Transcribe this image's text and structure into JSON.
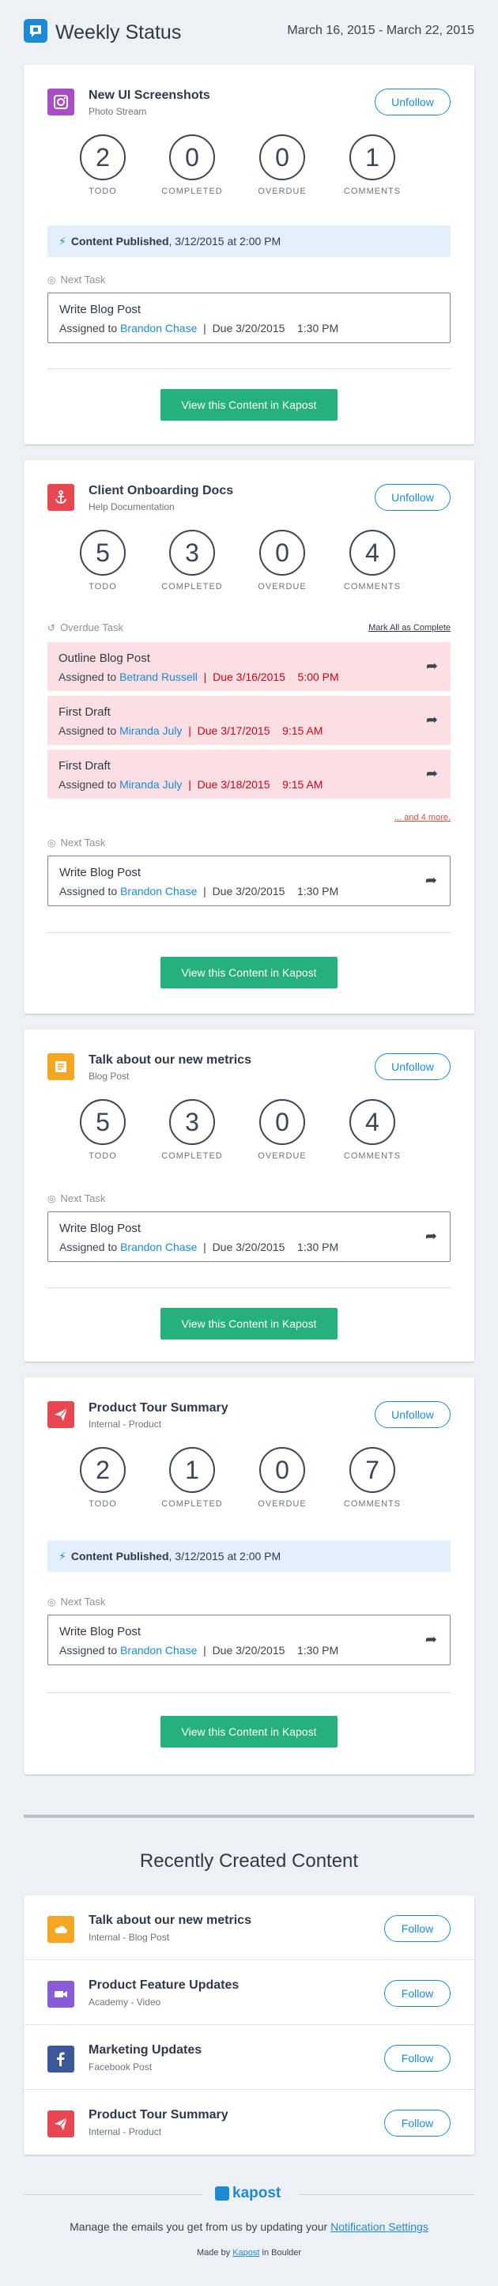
{
  "header": {
    "title": "Weekly Status",
    "date_range": "March 16, 2015 - March 22, 2015"
  },
  "stat_labels": {
    "todo": "TODO",
    "completed": "COMPLETED",
    "overdue": "OVERDUE",
    "comments": "COMMENTS"
  },
  "cards": [
    {
      "title": "New UI Screenshots",
      "subtitle": "Photo Stream",
      "icon": "instagram-icon",
      "icon_color": "#a84fc8",
      "unfollow_label": "Unfollow",
      "stats": {
        "todo": "2",
        "completed": "0",
        "overdue": "0",
        "comments": "1"
      },
      "published": {
        "label": "Content Published",
        "text": ", 3/12/2015 at 2:00 PM"
      },
      "next_task_label": "Next Task",
      "next_task": {
        "title": "Write Blog Post",
        "assigned_prefix": "Assigned to ",
        "assignee": "Brandon Chase",
        "sep": "|",
        "due": "Due 3/20/2015",
        "time": "1:30 PM"
      },
      "cta_label": "View this Content in Kapost"
    },
    {
      "title": "Client Onboarding Docs",
      "subtitle": "Help Documentation",
      "icon": "anchor-icon",
      "icon_color": "#e8474f",
      "unfollow_label": "Unfollow",
      "stats": {
        "todo": "5",
        "completed": "3",
        "overdue": "0",
        "comments": "4"
      },
      "overdue_label": "Overdue Task",
      "mark_all_label": "Mark All as Complete",
      "overdue_tasks": [
        {
          "title": "Outline Blog Post",
          "assigned_prefix": "Assigned to ",
          "assignee": "Betrand Russell",
          "sep": "|",
          "due": "Due 3/16/2015",
          "time": "5:00 PM"
        },
        {
          "title": "First Draft",
          "assigned_prefix": "Assigned to ",
          "assignee": "Miranda July",
          "sep": "|",
          "due": "Due 3/17/2015",
          "time": "9:15 AM"
        },
        {
          "title": "First Draft",
          "assigned_prefix": "Assigned to ",
          "assignee": "Miranda July",
          "sep": "|",
          "due": "Due 3/18/2015",
          "time": "9:15 AM"
        }
      ],
      "and_more_label": "... and 4 more.",
      "next_task_label": "Next Task",
      "next_task": {
        "title": "Write Blog Post",
        "assigned_prefix": "Assigned to ",
        "assignee": "Brandon Chase",
        "sep": "|",
        "due": "Due 3/20/2015",
        "time": "1:30 PM"
      },
      "cta_label": "View this Content in Kapost"
    },
    {
      "title": "Talk about our new metrics",
      "subtitle": "Blog Post",
      "icon": "document-icon",
      "icon_color": "#f5a623",
      "unfollow_label": "Unfollow",
      "stats": {
        "todo": "5",
        "completed": "3",
        "overdue": "0",
        "comments": "4"
      },
      "next_task_label": "Next Task",
      "next_task": {
        "title": "Write Blog Post",
        "assigned_prefix": "Assigned to ",
        "assignee": "Brandon Chase",
        "sep": "|",
        "due": "Due 3/20/2015",
        "time": "1:30 PM"
      },
      "cta_label": "View this Content in Kapost"
    },
    {
      "title": "Product Tour Summary",
      "subtitle": "Internal - Product",
      "icon": "paper-plane-icon",
      "icon_color": "#e8474f",
      "unfollow_label": "Unfollow",
      "stats": {
        "todo": "2",
        "completed": "1",
        "overdue": "0",
        "comments": "7"
      },
      "published": {
        "label": "Content Published",
        "text": ", 3/12/2015 at 2:00 PM"
      },
      "next_task_label": "Next Task",
      "next_task": {
        "title": "Write Blog Post",
        "assigned_prefix": "Assigned to ",
        "assignee": "Brandon Chase",
        "sep": "|",
        "due": "Due 3/20/2015",
        "time": "1:30 PM"
      },
      "cta_label": "View this Content in Kapost"
    }
  ],
  "recent": {
    "title": "Recently Created Content",
    "follow_label": "Follow",
    "items": [
      {
        "title": "Talk about our new metrics",
        "subtitle": "Internal - Blog Post",
        "icon": "cloud-icon",
        "icon_color": "#f5a623"
      },
      {
        "title": "Product Feature Updates",
        "subtitle": "Academy - Video",
        "icon": "video-camera-icon",
        "icon_color": "#8a5bd6"
      },
      {
        "title": "Marketing Updates",
        "subtitle": "Facebook Post",
        "icon": "facebook-icon",
        "icon_color": "#3b5998"
      },
      {
        "title": "Product Tour Summary",
        "subtitle": "Internal - Product",
        "icon": "paper-plane-icon",
        "icon_color": "#e8474f"
      }
    ]
  },
  "footer": {
    "logo_text": "kapost",
    "manage_prefix": "Manage the emails you get from us by updating your ",
    "manage_link": "Notification Settings",
    "made_prefix": "Made by ",
    "made_link": "Kapost",
    "made_suffix": " in Boulder"
  }
}
